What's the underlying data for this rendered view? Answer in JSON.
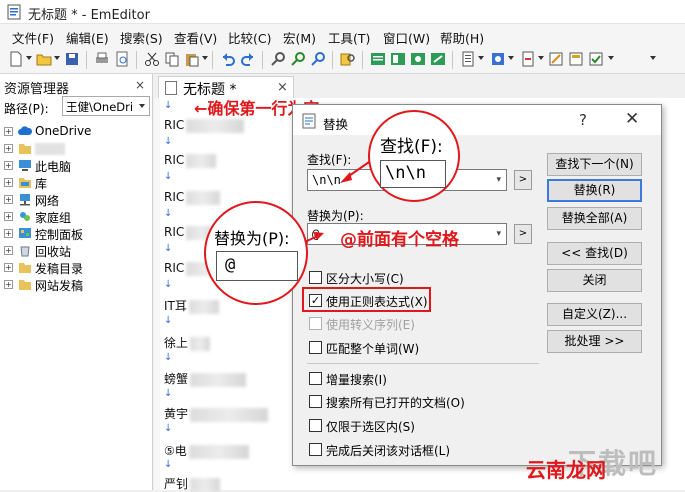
{
  "window": {
    "title": "无标题 * - EmEditor"
  },
  "menu": [
    "文件(F)",
    "编辑(E)",
    "搜索(S)",
    "查看(V)",
    "比较(C)",
    "宏(M)",
    "工具(T)",
    "窗口(W)",
    "帮助(H)"
  ],
  "toolbar_icons": [
    "new-file-icon",
    "open-folder-icon",
    "save-icon",
    "print-icon",
    "print-preview-icon",
    "cut-icon",
    "copy-icon",
    "paste-icon",
    "undo-icon",
    "redo-icon",
    "find-icon",
    "find-next-icon",
    "find-prev-icon",
    "find-in-files-icon",
    "view-mode-icon",
    "outline-icon",
    "sync-icon",
    "split-icon",
    "macro-icon",
    "plugin-icon",
    "config-icon",
    "customize-icon",
    "check-icon"
  ],
  "explorer": {
    "title": "资源管理器",
    "close": "×",
    "path_label": "路径(P):",
    "path_value": "王健\\OneDri",
    "items": [
      "OneDrive",
      "",
      "此电脑",
      "库",
      "网络",
      "家庭组",
      "控制面板",
      "回收站",
      "发稿目录",
      "网站发稿"
    ]
  },
  "tab": {
    "label": "无标题 *",
    "close": "×"
  },
  "editor": {
    "lines": [
      "RIC",
      "RIC",
      "RIC",
      "RIC",
      "RIC",
      "IT耳",
      "徐上",
      "螃蟹",
      "黄宇",
      "⑤电",
      "严钊"
    ]
  },
  "dialog": {
    "title": "替换",
    "help": "?",
    "close": "✕",
    "find_label": "查找(F):",
    "find_value": "\\n\\n",
    "replace_label": "替换为(P):",
    "replace_value": "@",
    "more": ">",
    "buttons": {
      "find_next": "查找下一个(N)",
      "replace": "替换(R)",
      "replace_all": "替换全部(A)",
      "find_less": "<< 查找(D)",
      "close": "关闭",
      "customize": "自定义(Z)...",
      "batch": "批处理 >>"
    },
    "options": [
      {
        "label": "区分大小写(C)",
        "checked": false,
        "disabled": false
      },
      {
        "label": "使用正则表达式(X)",
        "checked": true,
        "disabled": false
      },
      {
        "label": "使用转义序列(E)",
        "checked": false,
        "disabled": true
      },
      {
        "label": "匹配整个单词(W)",
        "checked": false,
        "disabled": false
      },
      {
        "label": "增量搜索(I)",
        "checked": false,
        "disabled": false
      },
      {
        "label": "搜索所有已打开的文档(O)",
        "checked": false,
        "disabled": false
      },
      {
        "label": "仅限于选区内(S)",
        "checked": false,
        "disabled": false
      },
      {
        "label": "完成后关闭该对话框(L)",
        "checked": false,
        "disabled": false
      }
    ],
    "check_mark": "✓"
  },
  "annotations": {
    "first_line_note": "←确保第一行为空",
    "find_zoom_label": "查找(F):",
    "find_zoom_value": "\\n\\n",
    "replace_zoom_label": "替换为(P):",
    "replace_zoom_value": "@",
    "space_note": "@前面有个空格"
  },
  "watermark": {
    "text": "下载吧",
    "brand": "云南龙网"
  },
  "colors": {
    "annotation_red": "#e0181c",
    "default_button_border": "#3b7ad9",
    "return_mark_blue": "#3a6fd6"
  }
}
